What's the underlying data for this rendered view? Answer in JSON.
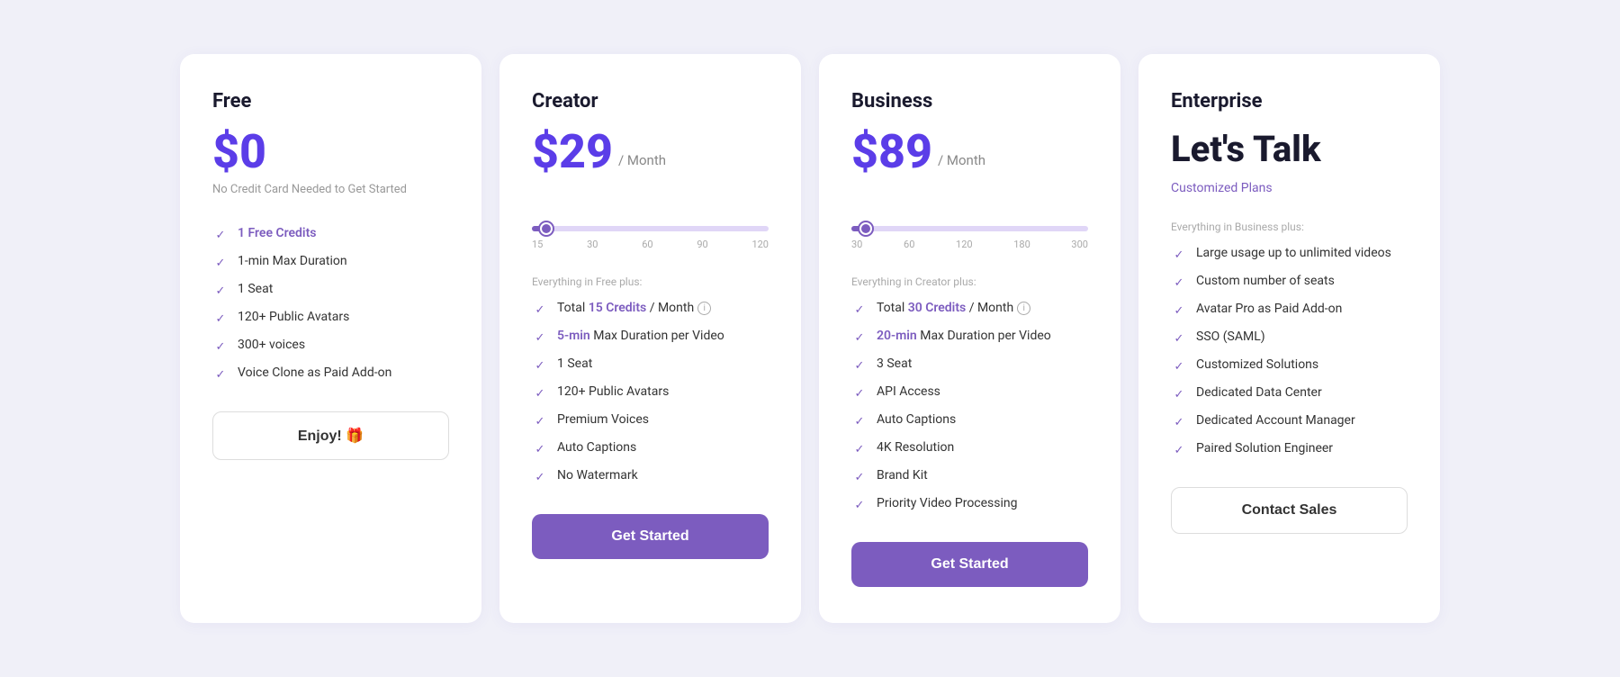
{
  "plans": [
    {
      "id": "free",
      "title": "Free",
      "price_symbol": "$",
      "price_amount": "0",
      "price_period": null,
      "price_note": "No Credit Card Needed to Get Started",
      "slider": null,
      "section_label": null,
      "features": [
        {
          "text": "1 Free Credits",
          "highlight": "1 Free Credits"
        },
        {
          "text": "1-min Max Duration",
          "highlight": null
        },
        {
          "text": "1 Seat",
          "highlight": null
        },
        {
          "text": "120+ Public Avatars",
          "highlight": null
        },
        {
          "text": "300+ voices",
          "highlight": null
        },
        {
          "text": "Voice Clone as Paid Add-on",
          "highlight": null
        }
      ],
      "cta_label": "Enjoy! 🎁",
      "cta_type": "outline"
    },
    {
      "id": "creator",
      "title": "Creator",
      "price_symbol": "$",
      "price_amount": "29",
      "price_period": "/ Month",
      "price_note": null,
      "slider": {
        "fill_pct": 6,
        "thumb_pct": 6,
        "labels": [
          "15",
          "30",
          "60",
          "90",
          "120"
        ]
      },
      "section_label": "Everything in Free plus:",
      "features": [
        {
          "text": "Total 15 Credits / Month",
          "highlight": "15 Credits",
          "info": true
        },
        {
          "text": "5-min Max Duration per Video",
          "highlight": "5-min"
        },
        {
          "text": "1 Seat",
          "highlight": null
        },
        {
          "text": "120+ Public Avatars",
          "highlight": null
        },
        {
          "text": "Premium Voices",
          "highlight": null
        },
        {
          "text": "Auto Captions",
          "highlight": null
        },
        {
          "text": "No Watermark",
          "highlight": null
        }
      ],
      "cta_label": "Get Started",
      "cta_type": "primary"
    },
    {
      "id": "business",
      "title": "Business",
      "price_symbol": "$",
      "price_amount": "89",
      "price_period": "/ Month",
      "price_note": null,
      "slider": {
        "fill_pct": 6,
        "thumb_pct": 6,
        "labels": [
          "30",
          "60",
          "120",
          "180",
          "300"
        ]
      },
      "section_label": "Everything in Creator plus:",
      "features": [
        {
          "text": "Total 30 Credits / Month",
          "highlight": "30 Credits",
          "info": true
        },
        {
          "text": "20-min Max Duration per Video",
          "highlight": "20-min"
        },
        {
          "text": "3 Seat",
          "highlight": null
        },
        {
          "text": "API Access",
          "highlight": null
        },
        {
          "text": "Auto Captions",
          "highlight": null
        },
        {
          "text": "4K Resolution",
          "highlight": null
        },
        {
          "text": "Brand Kit",
          "highlight": null
        },
        {
          "text": "Priority Video Processing",
          "highlight": null
        }
      ],
      "cta_label": "Get Started",
      "cta_type": "primary"
    },
    {
      "id": "enterprise",
      "title": "Enterprise",
      "price_symbol": null,
      "price_amount": null,
      "price_period": null,
      "price_note": null,
      "lets_talk": "Let's Talk",
      "customized_plans": "Customized Plans",
      "slider": null,
      "section_label": "Everything in Business plus:",
      "features": [
        {
          "text": "Large usage up to unlimited videos",
          "highlight": null
        },
        {
          "text": "Custom number of seats",
          "highlight": null
        },
        {
          "text": "Avatar Pro as Paid Add-on",
          "highlight": null
        },
        {
          "text": "SSO (SAML)",
          "highlight": null
        },
        {
          "text": "Customized Solutions",
          "highlight": null
        },
        {
          "text": "Dedicated Data Center",
          "highlight": null
        },
        {
          "text": "Dedicated Account Manager",
          "highlight": null
        },
        {
          "text": "Paired Solution Engineer",
          "highlight": null
        }
      ],
      "cta_label": "Contact Sales",
      "cta_type": "contact"
    }
  ]
}
